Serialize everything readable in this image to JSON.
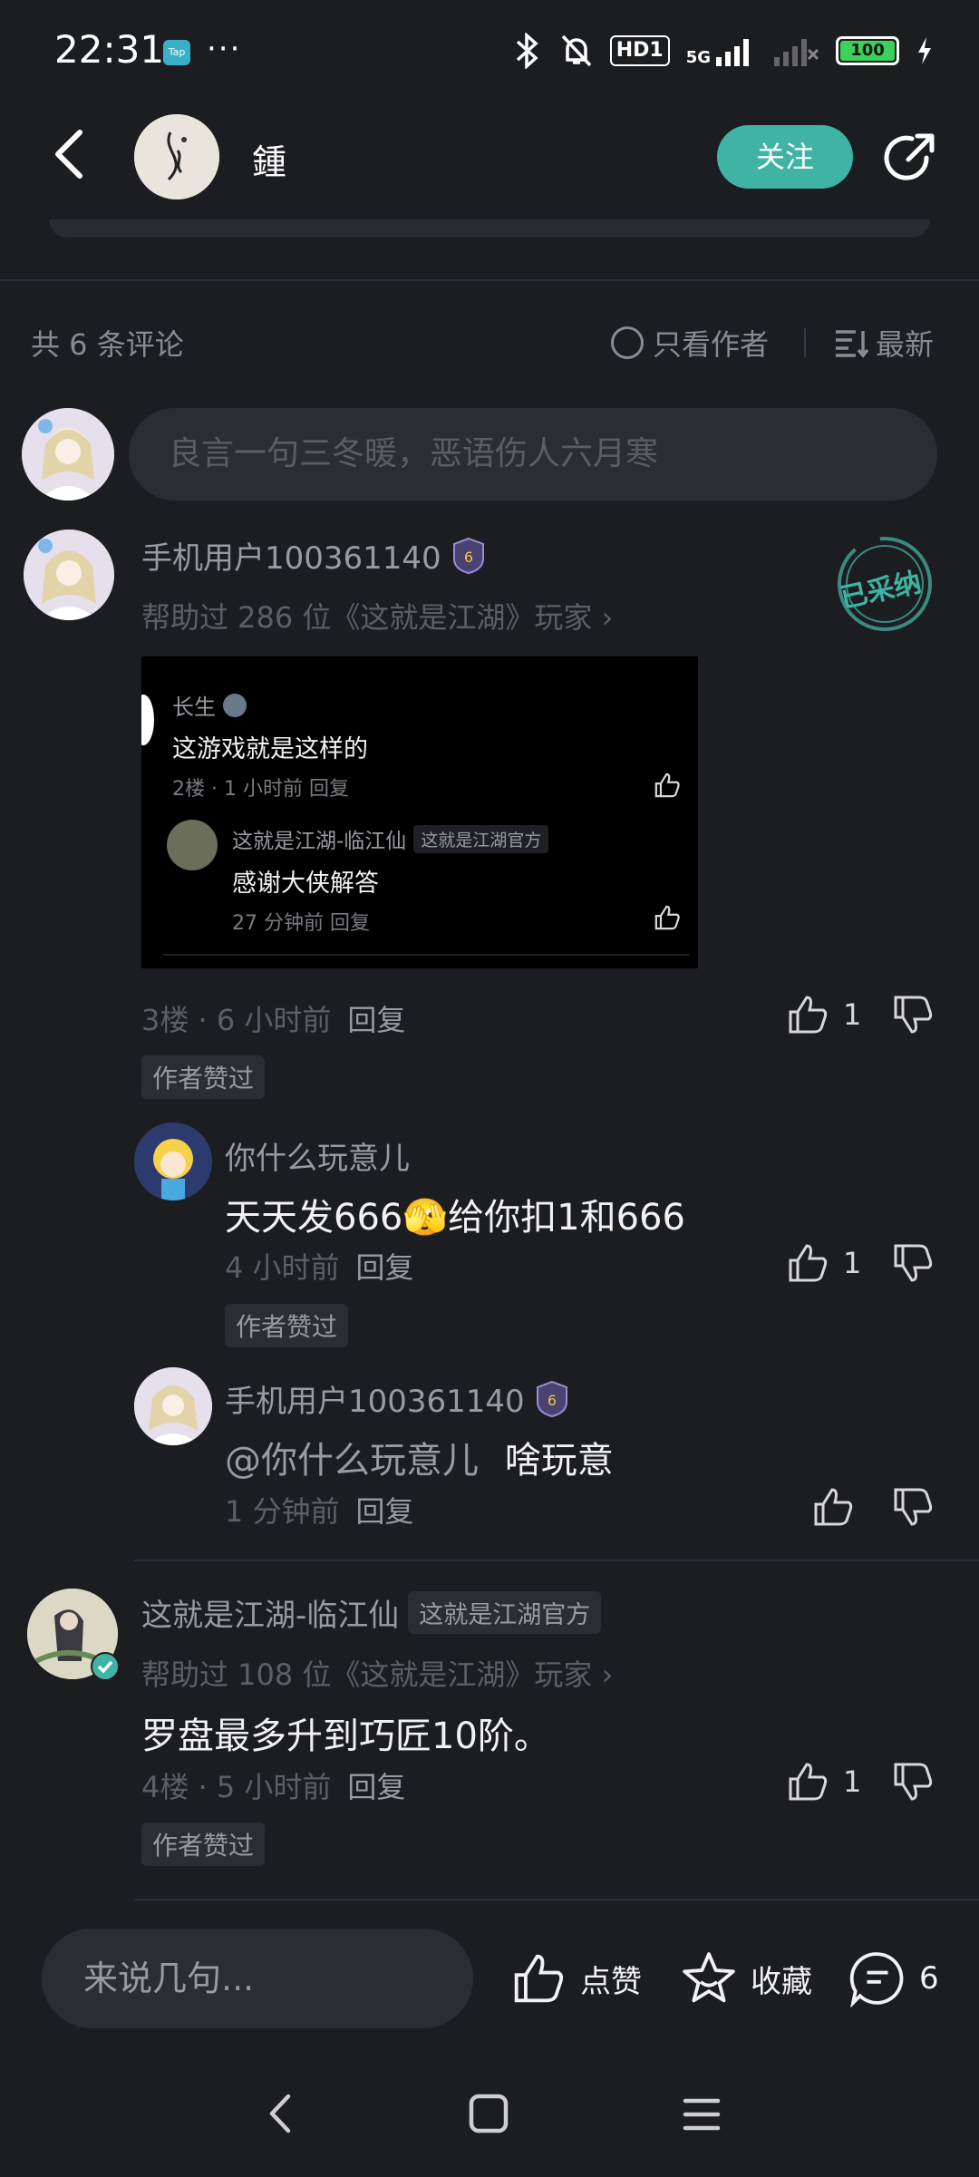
{
  "status_bar": {
    "time": "22:31",
    "tap_label": "Tap",
    "dots": "···",
    "hd": "HD1",
    "network": "5G",
    "battery": "100"
  },
  "header": {
    "name": "鍾",
    "follow_label": "关注"
  },
  "comments_bar": {
    "count_label": "共 6 条评论",
    "author_only_label": "只看作者",
    "sort_label": "最新"
  },
  "input": {
    "placeholder": "良言一句三冬暖，恶语伤人六月寒"
  },
  "comment1": {
    "username": "手机用户100361140",
    "help_text": "帮助过 286 位《这就是江湖》玩家 ›",
    "adopted_stamp": "已采纳",
    "embedded": {
      "user": "长生",
      "text": "这游戏就是这样的",
      "meta": "2楼 · 1 小时前  回复",
      "reply_user": "这就是江湖-临江仙",
      "reply_tag": "这就是江湖官方",
      "reply_text": "感谢大侠解答",
      "reply_meta": "27 分钟前  回复"
    },
    "floor_time": "3楼 · 6 小时前",
    "reply_label": "回复",
    "likes": "1",
    "author_liked": "作者赞过"
  },
  "reply1": {
    "username": "你什么玩意儿",
    "text": "天天发666🫣给你扣1和666",
    "time": "4 小时前",
    "reply_label": "回复",
    "likes": "1",
    "author_liked": "作者赞过"
  },
  "reply2": {
    "username": "手机用户100361140",
    "mention": "@你什么玩意儿",
    "text": "啥玩意",
    "time": "1 分钟前",
    "reply_label": "回复"
  },
  "comment2": {
    "username": "这就是江湖-临江仙",
    "official_tag": "这就是江湖官方",
    "help_text": "帮助过 108 位《这就是江湖》玩家 ›",
    "text": "罗盘最多升到巧匠10阶。",
    "floor_time": "4楼 · 5 小时前",
    "reply_label": "回复",
    "likes": "1",
    "author_liked": "作者赞过"
  },
  "bottom_bar": {
    "input_placeholder": "来说几句...",
    "like_label": "点赞",
    "collect_label": "收藏",
    "comment_count": "6"
  },
  "colors": {
    "background": "#1c1d21",
    "accent": "#3fb3a4",
    "muted": "#5e5f64"
  }
}
